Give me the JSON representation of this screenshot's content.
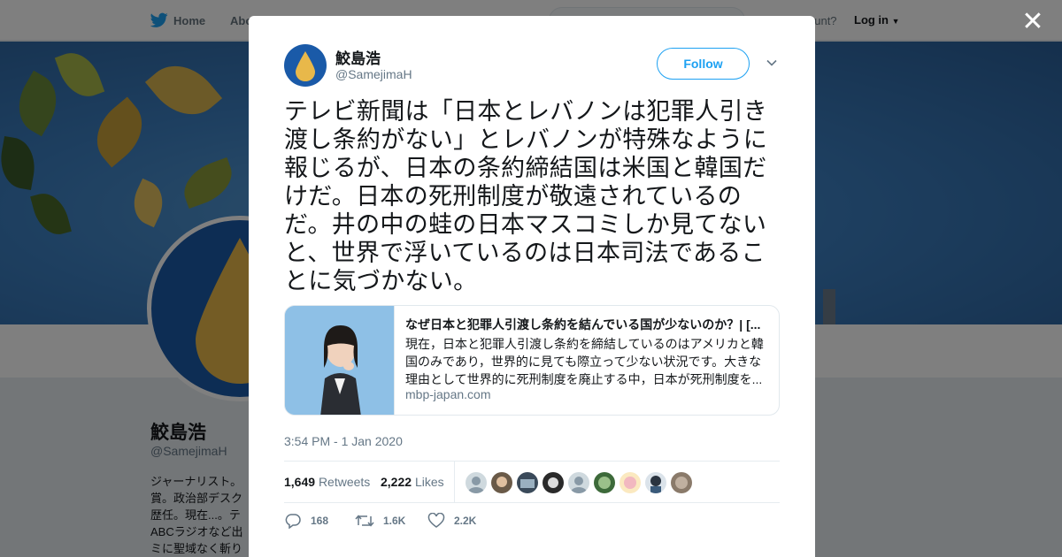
{
  "nav": {
    "home_label": "Home",
    "about_label": "Abo",
    "account_prompt": "ccount?",
    "login_label": "Log in"
  },
  "background_profile": {
    "name": "鮫島浩",
    "handle": "@SamejimaH",
    "bio_lines": [
      "ジャーナリスト。",
      "賞。政治部デスク",
      "歴任。現在...。テ",
      "ABCラジオなど出",
      "ミに聖域なく斬り"
    ]
  },
  "tweet": {
    "author_name": "鮫島浩",
    "author_handle": "@SamejimaH",
    "follow_label": "Follow",
    "text": "テレビ新聞は「日本とレバノンは犯罪人引き渡し条約がない」とレバノンが特殊なように報じるが、日本の条約締結国は米国と韓国だけだ。日本の死刑制度が敬遠されているのだ。井の中の蛙の日本マスコミしか見てないと、世界で浮いているのは日本司法であることに気づかない。",
    "timestamp": "3:54 PM - 1 Jan 2020",
    "card": {
      "title": "なぜ日本と犯罪人引渡し条約を結んでいる国が少ないのか？| [...",
      "description": "現在，日本と犯罪人引渡し条約を締結しているのはアメリカと韓国のみであり，世界的に見ても際立って少ない状況です。大きな理由として世界的に死刑制度を廃止する中，日本が死刑制度を...",
      "domain": "mbp-japan.com"
    },
    "stats": {
      "retweets_count": "1,649",
      "retweets_label": "Retweets",
      "likes_count": "2,222",
      "likes_label": "Likes"
    },
    "actions": {
      "replies": "168",
      "retweets": "1.6K",
      "likes": "2.2K"
    }
  },
  "colors": {
    "accent": "#1da1f2",
    "banner": "#3c7fc1",
    "avatar_bg": "#1a5aa8",
    "drop": "#e8b84a"
  }
}
